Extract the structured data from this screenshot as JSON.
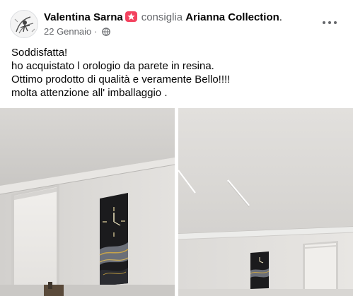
{
  "post": {
    "author": "Valentina Sarna",
    "verb": "consiglia",
    "page_name": "Arianna Collection",
    "page_name_suffix": ".",
    "date": "22 Gennaio",
    "separator": "·",
    "text_lines": [
      "Soddisfatta!",
      "ho acquistato l orologio da parete in resina.",
      "Ottimo prodotto di qualità e veramente Bello!!!!",
      "molta attenzione all' imballaggio ."
    ]
  },
  "icons": {
    "recommend_badge": "recommend-star-icon",
    "privacy": "globe-icon",
    "more": "more-options-icon"
  },
  "colors": {
    "badge": "#f3425f",
    "secondary_text": "#65676b",
    "primary_text": "#050505"
  }
}
